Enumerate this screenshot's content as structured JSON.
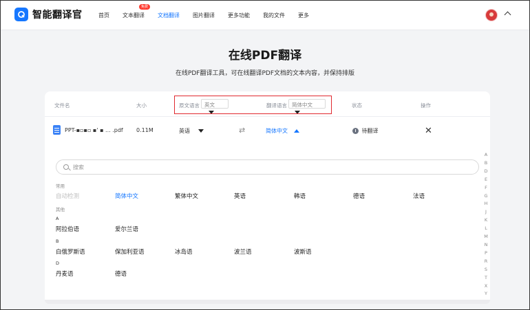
{
  "header": {
    "logo_text": "智能翻译官",
    "nav": [
      {
        "label": "首页"
      },
      {
        "label": "文本翻译",
        "badge": "免费"
      },
      {
        "label": "文档翻译",
        "active": true
      },
      {
        "label": "图片翻译"
      },
      {
        "label": "更多功能"
      },
      {
        "label": "我的文件"
      },
      {
        "label": "更多"
      }
    ]
  },
  "hero": {
    "title": "在线PDF翻译",
    "subtitle": "在线PDF翻译工具，可在线翻译PDF文档的文本内容，并保持排版"
  },
  "table": {
    "headers": {
      "file": "文件名",
      "size": "大小",
      "source": "原文语言",
      "target": "翻译语言",
      "status": "状态",
      "action": "操作"
    },
    "source_select": "英文",
    "target_select": "简体中文",
    "row": {
      "filename": "PPT-▪▫▪▫ ▪' ▪ ...  .pdf",
      "size": "0.11M",
      "source": "英语",
      "target": "简体中文",
      "status": "待翻译"
    }
  },
  "dropdown": {
    "search_placeholder": "搜索",
    "common_label": "常用",
    "common": [
      "自动检测",
      "简体中文",
      "繁体中文",
      "英语",
      "韩语",
      "德语",
      "法语"
    ],
    "other_label": "其他",
    "groups": [
      {
        "letter": "A",
        "items": [
          "阿拉伯语",
          "爱尔兰语"
        ]
      },
      {
        "letter": "B",
        "items": [
          "白俄罗斯语",
          "保加利亚语",
          "冰岛语",
          "波兰语",
          "波斯语"
        ]
      },
      {
        "letter": "D",
        "items": [
          "丹麦语",
          "德语"
        ]
      }
    ],
    "alphabet": [
      "A",
      "B",
      "D",
      "E",
      "F",
      "G",
      "H",
      "J",
      "K",
      "L",
      "M",
      "N",
      "P",
      "R",
      "S",
      "T",
      "X",
      "Y"
    ]
  },
  "colors": {
    "accent": "#1677ff",
    "highlight_box": "#e0282e"
  }
}
